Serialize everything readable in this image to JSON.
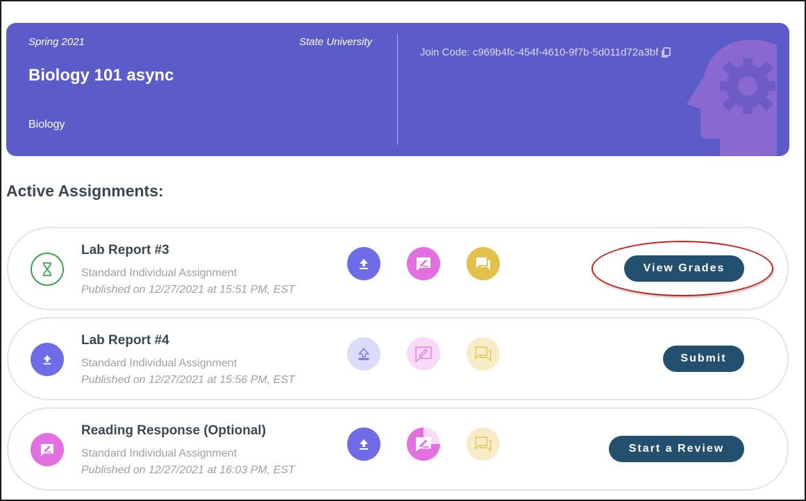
{
  "course": {
    "term": "Spring 2021",
    "university": "State University",
    "title": "Biology 101 async",
    "subject": "Biology",
    "join_code": "Join Code: c969b4fc-454f-4610-9f7b-5d011d72a3bf"
  },
  "section_title": "Active Assignments:",
  "colors": {
    "header_bg": "#5b5bc9",
    "upload": "#6f6ce8",
    "review": "#e46fe0",
    "feedback": "#e2c14a",
    "button": "#24506f",
    "pending": "#3aa64a"
  },
  "assignments": [
    {
      "title": "Lab Report #3",
      "type": "Standard Individual Assignment",
      "published": "Published on 12/27/2021 at 15:51 PM, EST",
      "status_icon": "hourglass-icon",
      "action_label": "View Grades"
    },
    {
      "title": "Lab Report #4",
      "type": "Standard Individual Assignment",
      "published": "Published on 12/27/2021 at 15:56 PM, EST",
      "status_icon": "upload-icon",
      "action_label": "Submit"
    },
    {
      "title": "Reading Response (Optional)",
      "type": "Standard Individual Assignment",
      "published": "Published on 12/27/2021 at 16:03 PM, EST",
      "status_icon": "review-icon",
      "action_label": "Start a Review"
    }
  ]
}
